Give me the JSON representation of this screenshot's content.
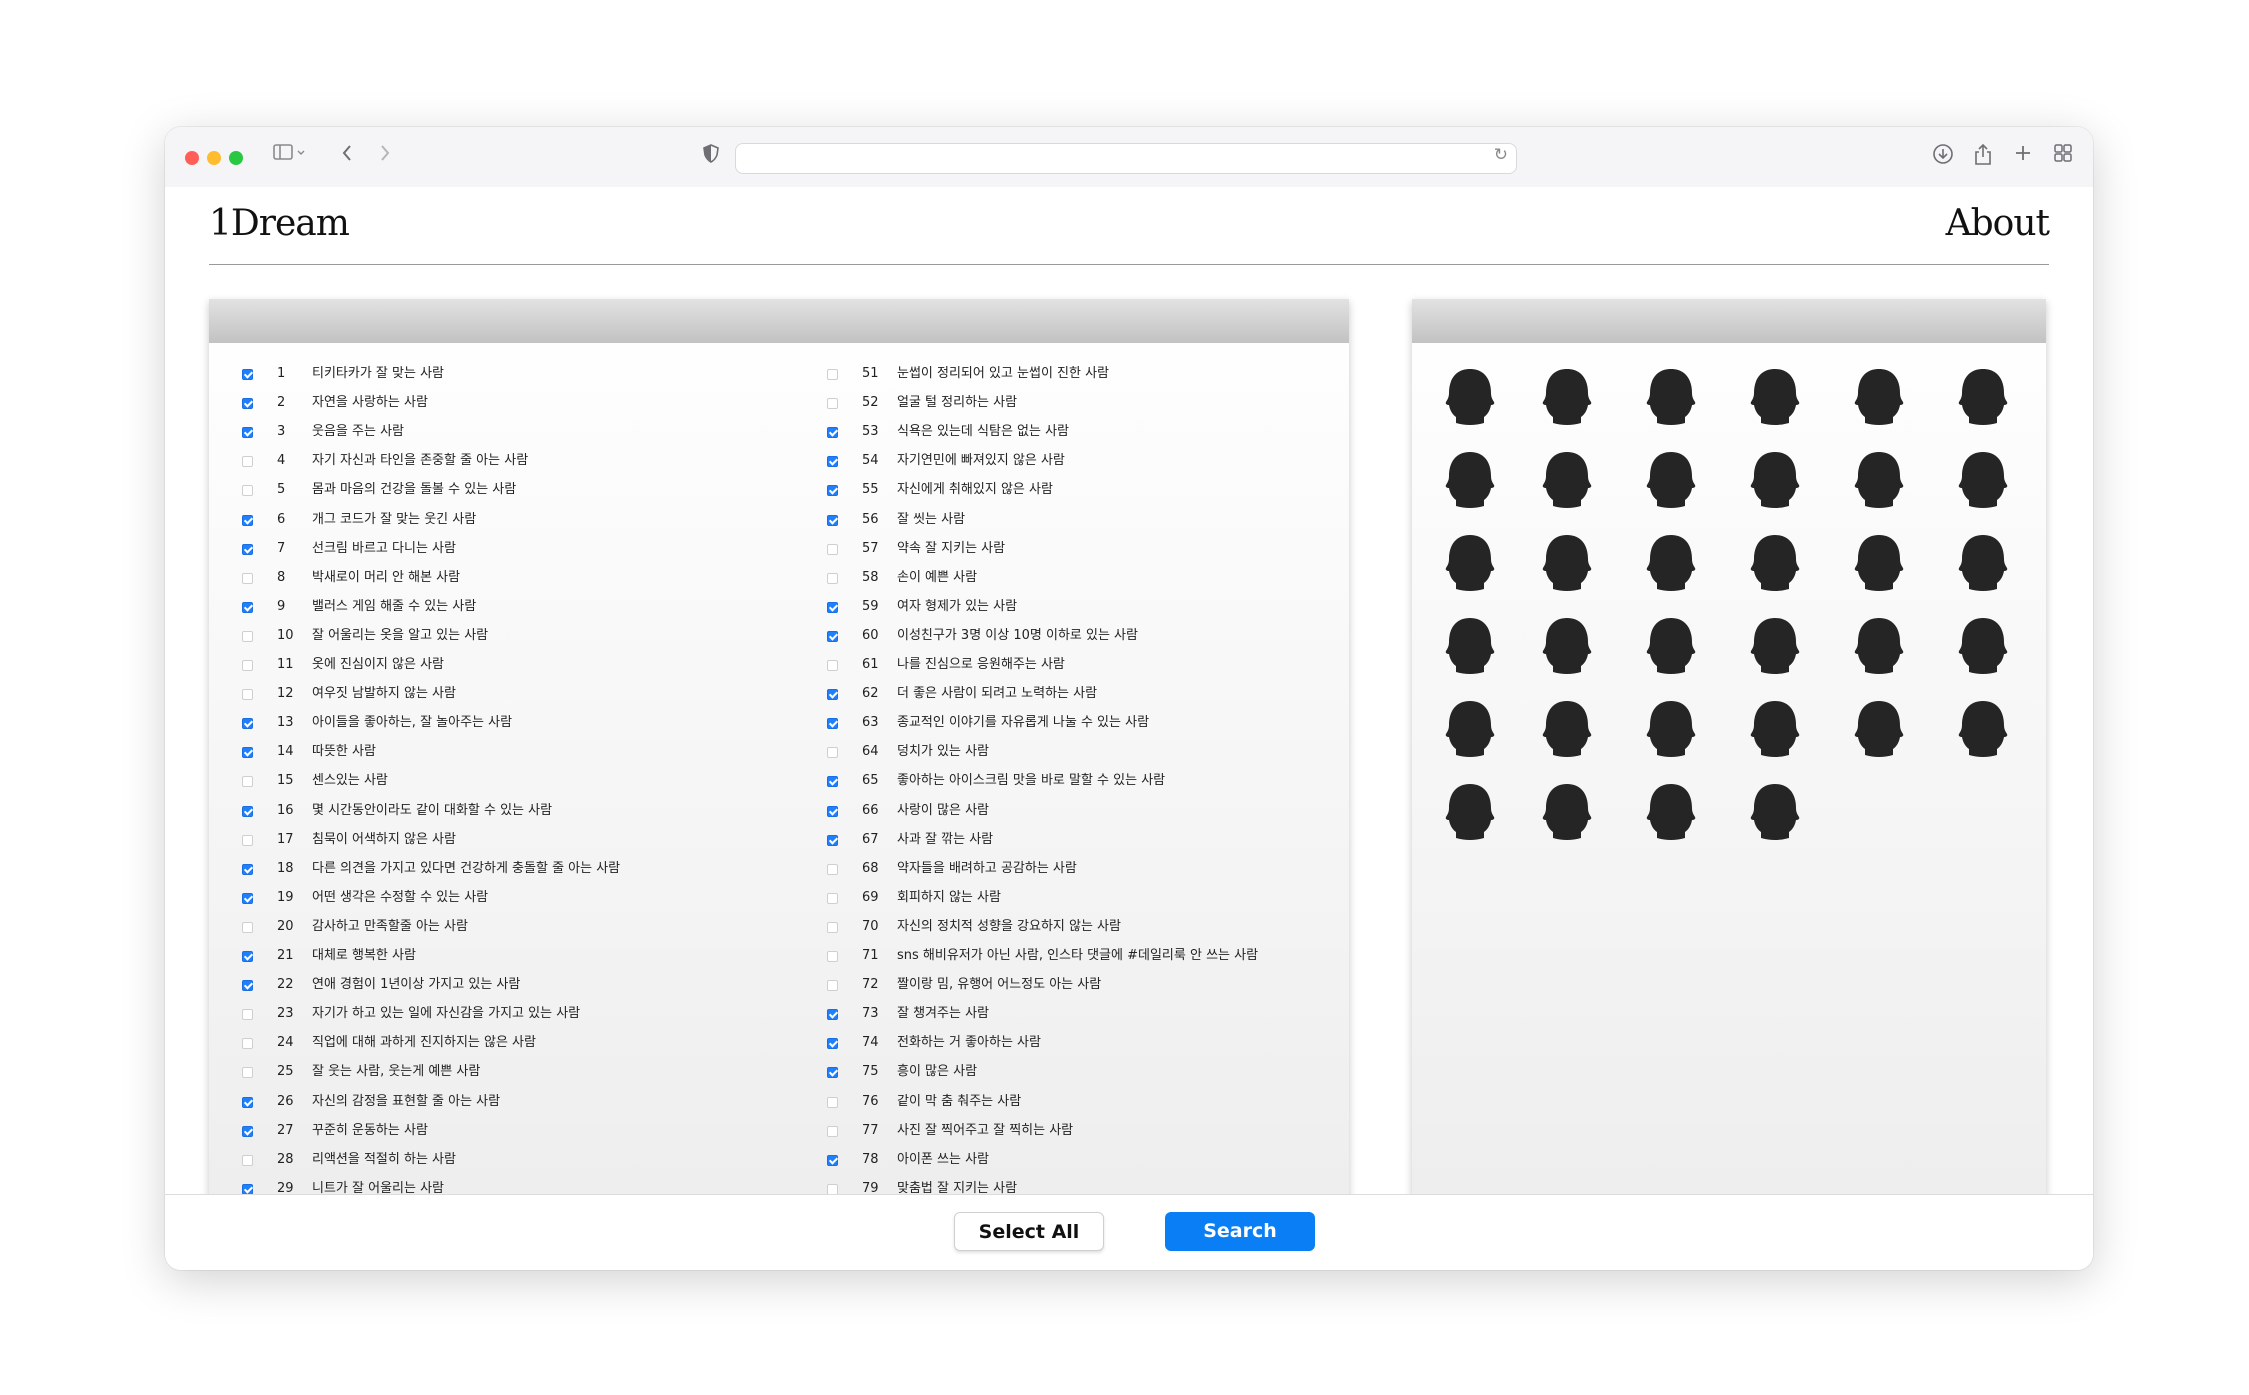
{
  "site": {
    "logo": "1Dream",
    "about": "About"
  },
  "buttons": {
    "select_all": "Select All",
    "search": "Search"
  },
  "colors": {
    "accent": "#0a7ff5",
    "head": "#252525"
  },
  "icons": [
    "sidebar-icon",
    "back-icon",
    "forward-icon",
    "shield-icon",
    "reload-icon",
    "download-icon",
    "share-icon",
    "new-tab-icon",
    "tab-overview-icon"
  ],
  "avatars_count": 34,
  "left_items": [
    {
      "n": "1",
      "t": "티키타카가 잘 맞는 사람",
      "c": true
    },
    {
      "n": "2",
      "t": "자연을 사랑하는 사람",
      "c": true
    },
    {
      "n": "3",
      "t": "웃음을 주는 사람",
      "c": true
    },
    {
      "n": "4",
      "t": "자기 자신과 타인을 존중할 줄 아는 사람",
      "c": false
    },
    {
      "n": "5",
      "t": "몸과 마음의 건강을 돌볼 수 있는 사람",
      "c": false
    },
    {
      "n": "6",
      "t": "개그 코드가 잘 맞는 웃긴 사람",
      "c": true
    },
    {
      "n": "7",
      "t": "선크림 바르고 다니는 사람",
      "c": true
    },
    {
      "n": "8",
      "t": "박새로이 머리 안 해본 사람",
      "c": false
    },
    {
      "n": "9",
      "t": "밸러스 게임 해줄 수 있는 사람",
      "c": true
    },
    {
      "n": "10",
      "t": "잘 어울리는 옷을 알고 있는 사람",
      "c": false
    },
    {
      "n": "11",
      "t": "옷에 진심이지 않은 사람",
      "c": false
    },
    {
      "n": "12",
      "t": "여우짓 남발하지 않는 사람",
      "c": false
    },
    {
      "n": "13",
      "t": "아이들을 좋아하는, 잘 놀아주는 사람",
      "c": true
    },
    {
      "n": "14",
      "t": "따뜻한 사람",
      "c": true
    },
    {
      "n": "15",
      "t": "센스있는 사람",
      "c": false
    },
    {
      "n": "16",
      "t": "몇 시간동안이라도 같이 대화할 수 있는 사람",
      "c": true
    },
    {
      "n": "17",
      "t": "침묵이 어색하지 않은 사람",
      "c": false
    },
    {
      "n": "18",
      "t": "다른 의견을 가지고 있다면 건강하게 충돌할 줄 아는 사람",
      "c": true
    },
    {
      "n": "19",
      "t": "어떤 생각은 수정할 수 있는 사람",
      "c": true
    },
    {
      "n": "20",
      "t": "감사하고 만족할줄 아는 사람",
      "c": false
    },
    {
      "n": "21",
      "t": "대체로 행복한 사람",
      "c": true
    },
    {
      "n": "22",
      "t": "연애 경험이 1년이상 가지고 있는 사람",
      "c": true
    },
    {
      "n": "23",
      "t": "자기가 하고 있는 일에 자신감을 가지고 있는 사람",
      "c": false
    },
    {
      "n": "24",
      "t": "직업에 대해 과하게 진지하지는 않은 사람",
      "c": false
    },
    {
      "n": "25",
      "t": "잘 웃는 사람, 웃는게 예쁜 사람",
      "c": false
    },
    {
      "n": "26",
      "t": "자신의 감정을 표현할 줄 아는 사람",
      "c": true
    },
    {
      "n": "27",
      "t": "꾸준히 운동하는 사람",
      "c": true
    },
    {
      "n": "28",
      "t": "리액션을 적절히 하는 사람",
      "c": false
    },
    {
      "n": "29",
      "t": "니트가 잘 어울리는 사람",
      "c": true
    }
  ],
  "right_items": [
    {
      "n": "51",
      "t": "눈썹이 정리되어 있고 눈썹이 진한 사람",
      "c": false
    },
    {
      "n": "52",
      "t": "얼굴 털 정리하는 사람",
      "c": false
    },
    {
      "n": "53",
      "t": "식욕은 있는데 식탐은 없는 사람",
      "c": true
    },
    {
      "n": "54",
      "t": "자기연민에 빠져있지 않은 사람",
      "c": true
    },
    {
      "n": "55",
      "t": "자신에게 취해있지 않은 사람",
      "c": true
    },
    {
      "n": "56",
      "t": "잘 씻는 사람",
      "c": true
    },
    {
      "n": "57",
      "t": "약속 잘 지키는 사람",
      "c": false
    },
    {
      "n": "58",
      "t": "손이 예쁜 사람",
      "c": false
    },
    {
      "n": "59",
      "t": "여자 형제가 있는 사람",
      "c": true
    },
    {
      "n": "60",
      "t": "이성친구가 3명 이상 10명 이하로 있는 사람",
      "c": true
    },
    {
      "n": "61",
      "t": "나를 진심으로 응원해주는 사람",
      "c": false
    },
    {
      "n": "62",
      "t": "더 좋은 사람이 되려고 노력하는 사람",
      "c": true
    },
    {
      "n": "63",
      "t": "종교적인 이야기를 자유롭게 나눌 수 있는 사람",
      "c": true
    },
    {
      "n": "64",
      "t": "덩치가 있는 사람",
      "c": false
    },
    {
      "n": "65",
      "t": "좋아하는 아이스크림 맛을 바로 말할 수 있는 사람",
      "c": true
    },
    {
      "n": "66",
      "t": "사랑이 많은 사람",
      "c": true
    },
    {
      "n": "67",
      "t": "사과 잘 깎는 사람",
      "c": true
    },
    {
      "n": "68",
      "t": "약자들을 배려하고 공감하는 사람",
      "c": false
    },
    {
      "n": "69",
      "t": "회피하지 않는 사람",
      "c": false
    },
    {
      "n": "70",
      "t": "자신의 정치적 성향을 강요하지 않는 사람",
      "c": false
    },
    {
      "n": "71",
      "t": "sns 해비유저가 아닌 사람, 인스타 댓글에 #데일리룩 안 쓰는 사람",
      "c": false
    },
    {
      "n": "72",
      "t": "짤이랑 밈, 유행어 어느정도 아는 사람",
      "c": false
    },
    {
      "n": "73",
      "t": "잘 챙겨주는 사람",
      "c": true
    },
    {
      "n": "74",
      "t": "전화하는 거 좋아하는 사람",
      "c": true
    },
    {
      "n": "75",
      "t": "흥이 많은 사람",
      "c": true
    },
    {
      "n": "76",
      "t": "같이 막 춤 춰주는 사람",
      "c": false
    },
    {
      "n": "77",
      "t": "사진 잘 찍어주고 잘 찍히는 사람",
      "c": false
    },
    {
      "n": "78",
      "t": "아이폰 쓰는 사람",
      "c": true
    },
    {
      "n": "79",
      "t": "맞춤법 잘 지키는 사람",
      "c": false
    }
  ]
}
